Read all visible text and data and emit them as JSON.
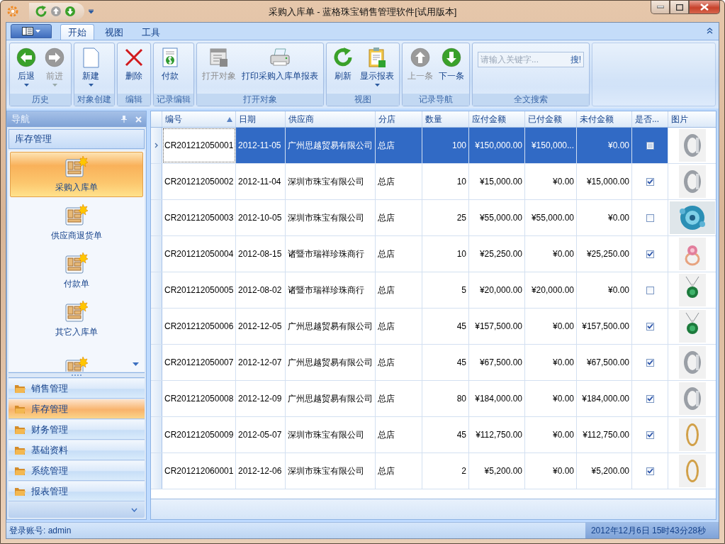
{
  "window": {
    "title": "采购入库单 - 蓝格珠宝销售管理软件[试用版本]"
  },
  "ribbon": {
    "tabs": [
      {
        "label": "开始",
        "selected": true
      },
      {
        "label": "视图",
        "selected": false
      },
      {
        "label": "工具",
        "selected": false
      }
    ],
    "groups": [
      {
        "label": "历史",
        "buttons": [
          {
            "kind": "back",
            "label": "后退",
            "disabled": false,
            "dropdown": true
          },
          {
            "kind": "forward",
            "label": "前进",
            "disabled": true,
            "dropdown": true
          }
        ]
      },
      {
        "label": "对象创建",
        "buttons": [
          {
            "kind": "new",
            "label": "新建",
            "disabled": false,
            "dropdown": true
          }
        ]
      },
      {
        "label": "编辑",
        "buttons": [
          {
            "kind": "delete",
            "label": "删除",
            "disabled": false,
            "dropdown": false
          }
        ]
      },
      {
        "label": "记录编辑",
        "buttons": [
          {
            "kind": "payment",
            "label": "付款",
            "disabled": false,
            "dropdown": false
          }
        ]
      },
      {
        "label": "打开对象",
        "buttons": [
          {
            "kind": "open",
            "label": "打开对象",
            "disabled": true,
            "dropdown": false
          },
          {
            "kind": "print",
            "label": "打印采购入库单报表",
            "disabled": false,
            "dropdown": false
          }
        ]
      },
      {
        "label": "视图",
        "buttons": [
          {
            "kind": "refresh",
            "label": "刷新",
            "disabled": false,
            "dropdown": false
          },
          {
            "kind": "report",
            "label": "显示报表",
            "disabled": false,
            "dropdown": true
          }
        ]
      },
      {
        "label": "记录导航",
        "buttons": [
          {
            "kind": "up",
            "label": "上一条",
            "disabled": true,
            "dropdown": false
          },
          {
            "kind": "down",
            "label": "下一条",
            "disabled": false,
            "dropdown": false
          }
        ]
      },
      {
        "label": "全文搜索",
        "search": {
          "placeholder": "请输入关键字...",
          "button": "搜!"
        }
      }
    ]
  },
  "navigation": {
    "title": "导航",
    "group_title": "库存管理",
    "items": [
      {
        "label": "采购入库单",
        "selected": true
      },
      {
        "label": "供应商退货单",
        "selected": false
      },
      {
        "label": "付款单",
        "selected": false
      },
      {
        "label": "其它入库单",
        "selected": false
      },
      {
        "selected": false
      }
    ],
    "groups": [
      {
        "label": "销售管理",
        "selected": false
      },
      {
        "label": "库存管理",
        "selected": true
      },
      {
        "label": "财务管理",
        "selected": false
      },
      {
        "label": "基础资料",
        "selected": false
      },
      {
        "label": "系统管理",
        "selected": false
      },
      {
        "label": "报表管理",
        "selected": false
      }
    ]
  },
  "table": {
    "columns": [
      "编号",
      "日期",
      "供应商",
      "分店",
      "数量",
      "应付金额",
      "已付金额",
      "未付金额",
      "是否...",
      "图片"
    ],
    "rows": [
      {
        "id": "CR201212050001",
        "date": "2012-11-05",
        "supplier": "广州思越贸易有限公司",
        "branch": "总店",
        "qty": "100",
        "payable": "¥150,000.00",
        "paid": "¥150,000...",
        "unpaid": "¥0.00",
        "checked": false,
        "selected": true
      },
      {
        "id": "CR201212050002",
        "date": "2012-11-04",
        "supplier": "深圳市珠宝有限公司",
        "branch": "总店",
        "qty": "10",
        "payable": "¥15,000.00",
        "paid": "¥0.00",
        "unpaid": "¥15,000.00",
        "checked": true,
        "selected": false
      },
      {
        "id": "CR201212050003",
        "date": "2012-10-05",
        "supplier": "深圳市珠宝有限公司",
        "branch": "总店",
        "qty": "25",
        "payable": "¥55,000.00",
        "paid": "¥55,000.00",
        "unpaid": "¥0.00",
        "checked": false,
        "selected": false
      },
      {
        "id": "CR201212050004",
        "date": "2012-08-15",
        "supplier": "诸暨市瑞祥珍珠商行",
        "branch": "总店",
        "qty": "10",
        "payable": "¥25,250.00",
        "paid": "¥0.00",
        "unpaid": "¥25,250.00",
        "checked": true,
        "selected": false
      },
      {
        "id": "CR201212050005",
        "date": "2012-08-02",
        "supplier": "诸暨市瑞祥珍珠商行",
        "branch": "总店",
        "qty": "5",
        "payable": "¥20,000.00",
        "paid": "¥20,000.00",
        "unpaid": "¥0.00",
        "checked": false,
        "selected": false
      },
      {
        "id": "CR201212050006",
        "date": "2012-12-05",
        "supplier": "广州思越贸易有限公司",
        "branch": "总店",
        "qty": "45",
        "payable": "¥157,500.00",
        "paid": "¥0.00",
        "unpaid": "¥157,500.00",
        "checked": true,
        "selected": false
      },
      {
        "id": "CR201212050007",
        "date": "2012-12-07",
        "supplier": "广州思越贸易有限公司",
        "branch": "总店",
        "qty": "45",
        "payable": "¥67,500.00",
        "paid": "¥0.00",
        "unpaid": "¥67,500.00",
        "checked": true,
        "selected": false
      },
      {
        "id": "CR201212050008",
        "date": "2012-12-09",
        "supplier": "广州思越贸易有限公司",
        "branch": "总店",
        "qty": "80",
        "payable": "¥184,000.00",
        "paid": "¥0.00",
        "unpaid": "¥184,000.00",
        "checked": true,
        "selected": false
      },
      {
        "id": "CR201212050009",
        "date": "2012-05-07",
        "supplier": "深圳市珠宝有限公司",
        "branch": "总店",
        "qty": "45",
        "payable": "¥112,750.00",
        "paid": "¥0.00",
        "unpaid": "¥112,750.00",
        "checked": true,
        "selected": false
      },
      {
        "id": "CR201212060001",
        "date": "2012-12-06",
        "supplier": "深圳市珠宝有限公司",
        "branch": "总店",
        "qty": "2",
        "payable": "¥5,200.00",
        "paid": "¥0.00",
        "unpaid": "¥5,200.00",
        "checked": true,
        "selected": false
      }
    ]
  },
  "status_bar": {
    "account": "登录账号: admin",
    "datetime": "2012年12月6日 15时43分28秒"
  }
}
